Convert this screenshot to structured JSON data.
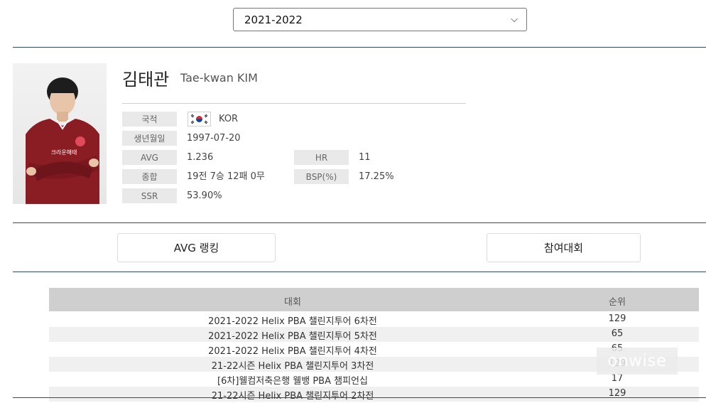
{
  "season_select": {
    "value": "2021-2022"
  },
  "player": {
    "name_ko": "김태관",
    "name_en": "Tae-kwan KIM"
  },
  "info": {
    "nationality_label": "국적",
    "nationality_value": "KOR",
    "birth_label": "생년월일",
    "birth_value": "1997-07-20",
    "avg_label": "AVG",
    "avg_value": "1.236",
    "hr_label": "HR",
    "hr_value": "11",
    "record_label": "종합",
    "record_value": "19전 7승 12패 0무",
    "bsp_label": "BSP(%)",
    "bsp_value": "17.25%",
    "ssr_label": "SSR",
    "ssr_value": "53.90%"
  },
  "tabs": {
    "avg_ranking": "AVG 랭킹",
    "tournaments": "참여대회"
  },
  "table": {
    "headers": {
      "tournament": "대회",
      "rank": "순위"
    },
    "rows": [
      {
        "tournament": "2021-2022 Helix PBA 챌린지투어 6차전",
        "rank": "129"
      },
      {
        "tournament": "2021-2022 Helix PBA 챌린지투어 5차전",
        "rank": "65"
      },
      {
        "tournament": "2021-2022 Helix PBA 챌린지투어 4차전",
        "rank": "65"
      },
      {
        "tournament": "21-22시즌 Helix PBA 챌린지투어 3차전",
        "rank": "129"
      },
      {
        "tournament": "[6차]웰컴저축은행 웰뱅 PBA 챔피언십",
        "rank": "17"
      },
      {
        "tournament": "21-22시즌 Helix PBA 챌린지투어 2차전",
        "rank": "129"
      }
    ]
  },
  "watermark": "onwise",
  "colors": {
    "divider": "#2f4a6b",
    "label_bg": "#e9e9e9",
    "table_head_bg": "#cfcfcf",
    "jersey": "#8a1c24"
  }
}
